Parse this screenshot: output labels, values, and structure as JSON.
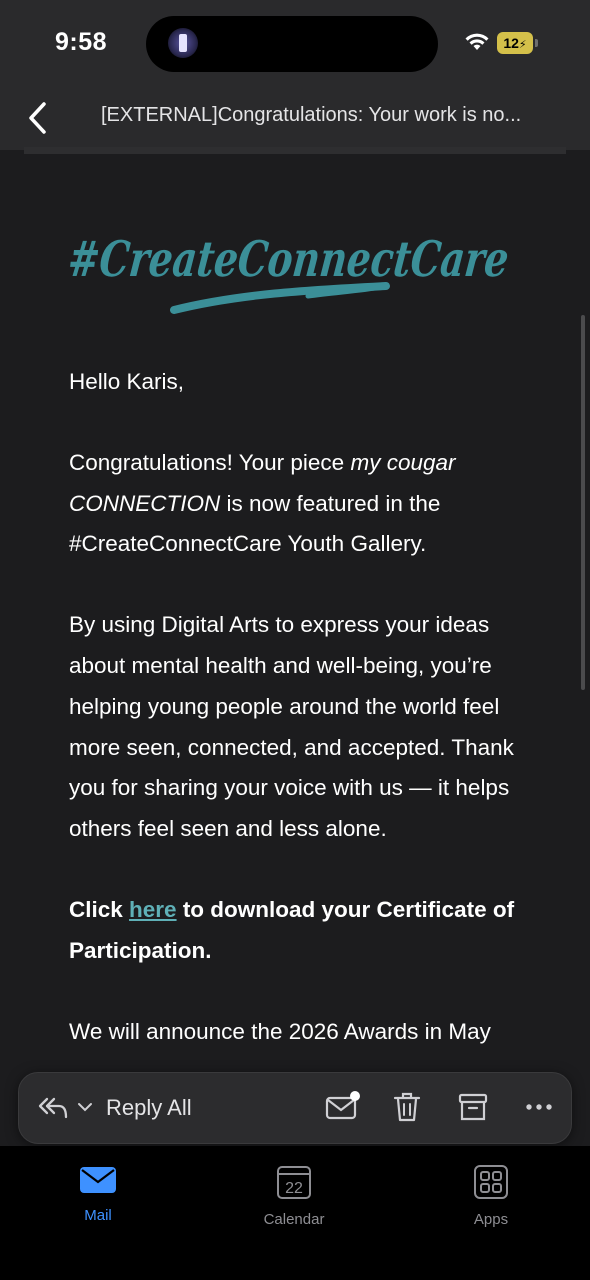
{
  "status_bar": {
    "time": "9:58",
    "battery": "12"
  },
  "header": {
    "subject": "[EXTERNAL]Congratulations: Your work is no..."
  },
  "email": {
    "greeting": "Hello Karis,",
    "p1_start": "Congratulations! Your piece ",
    "p1_title": "my cougar CONNECTION",
    "p1_end": " is now featured in the #CreateConnectCare Youth Gallery.",
    "p2": "By using Digital Arts to express your ideas about mental health and well-being, you’re helping young people around the world feel more seen, connected, and accepted. Thank you for sharing your voice with us — it helps others feel seen and less alone.",
    "p3_start": "Click ",
    "p3_link": "here",
    "p3_end": " to download your Certificate of Participation.",
    "p4": "We will announce the 2026 Awards in May",
    "logo_text": "#CreateConnectCare"
  },
  "action_bar": {
    "reply_label": "Reply All",
    "icons": [
      "reply-all-icon",
      "chevron-down-icon",
      "mark-unread-icon",
      "trash-icon",
      "archive-icon",
      "more-icon"
    ]
  },
  "tabs": [
    {
      "label": "Mail",
      "icon": "mail-icon",
      "active": true
    },
    {
      "label": "Calendar",
      "icon": "calendar-icon",
      "badge": "22",
      "active": false
    },
    {
      "label": "Apps",
      "icon": "apps-icon",
      "active": false
    }
  ],
  "colors": {
    "accent": "#3e91ff",
    "link": "#5fb0b7",
    "logo": "#3b8f98",
    "background": "#1c1c1e"
  }
}
